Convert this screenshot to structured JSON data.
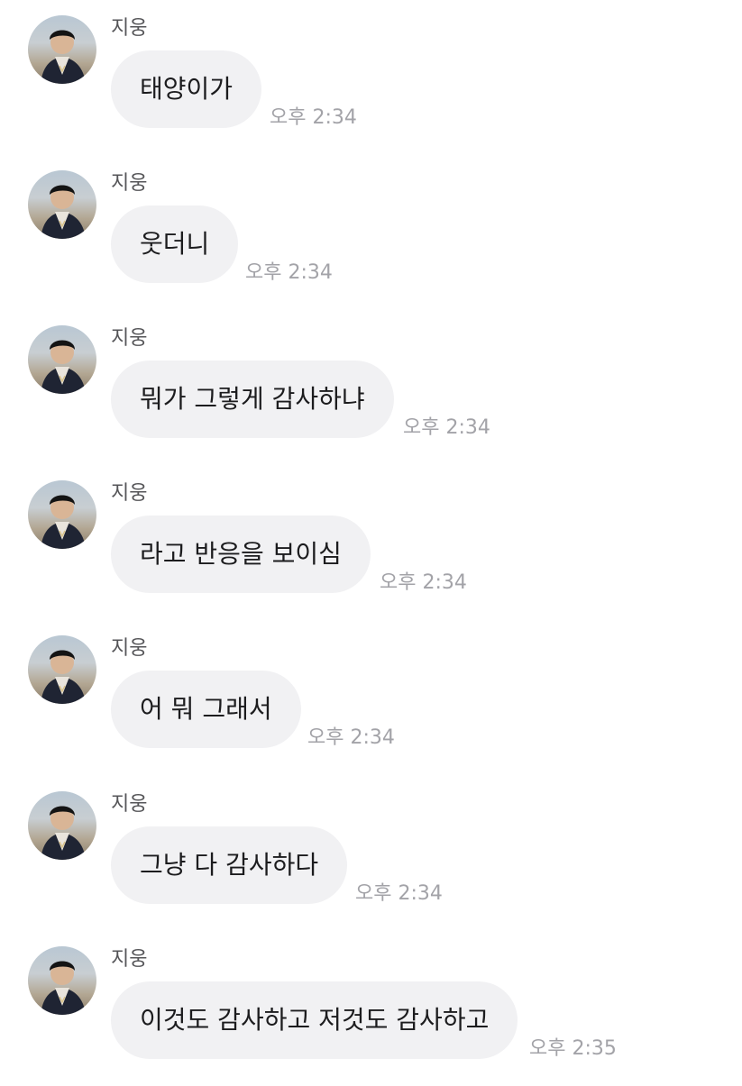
{
  "messages": [
    {
      "sender": "지웅",
      "text": "태양이가",
      "time": "오후 2:34"
    },
    {
      "sender": "지웅",
      "text": "웃더니",
      "time": "오후 2:34"
    },
    {
      "sender": "지웅",
      "text": "뭐가 그렇게 감사하냐",
      "time": "오후 2:34"
    },
    {
      "sender": "지웅",
      "text": "라고 반응을 보이심",
      "time": "오후 2:34"
    },
    {
      "sender": "지웅",
      "text": "어 뭐 그래서",
      "time": "오후 2:34"
    },
    {
      "sender": "지웅",
      "text": "그냥 다 감사하다",
      "time": "오후 2:34"
    },
    {
      "sender": "지웅",
      "text": "이것도 감사하고 저것도 감사하고",
      "time": "오후 2:35"
    }
  ],
  "colors": {
    "bubble": "#f1f1f3",
    "message_text": "#1c1c1e",
    "sender_text": "#555558",
    "time_text": "#a3a3a8"
  },
  "icons": {
    "avatar": "user-photo-avatar"
  }
}
